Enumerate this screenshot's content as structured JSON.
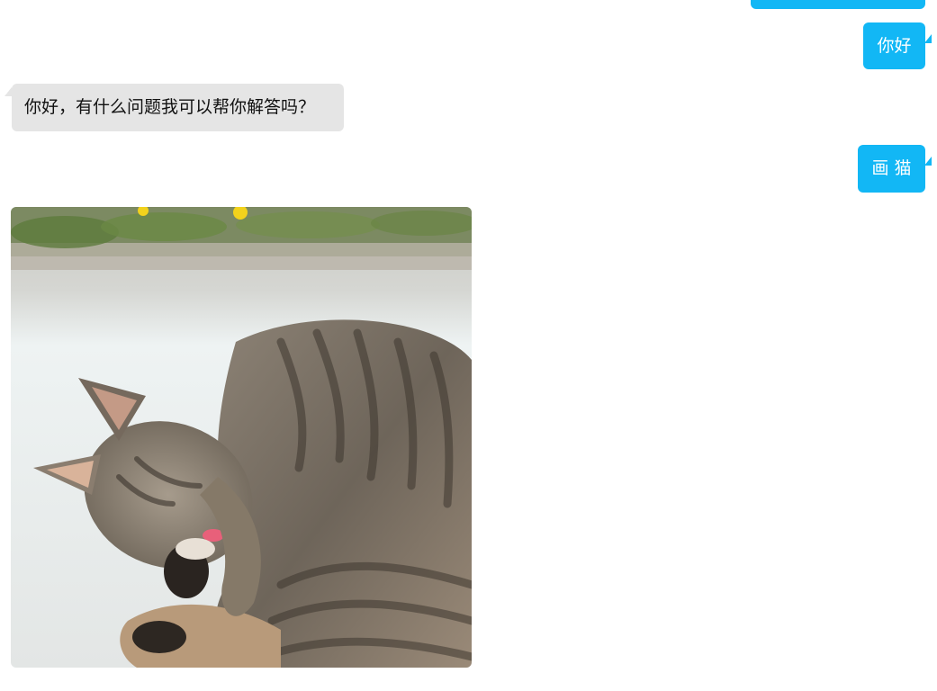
{
  "theme": {
    "user_bubble_color": "#12b7f5",
    "bot_bubble_color": "#e5e5e5"
  },
  "messages": [
    {
      "role": "user",
      "text": ""
    },
    {
      "role": "user",
      "text": "你好"
    },
    {
      "role": "assistant",
      "text": "你好，有什么问题我可以帮你解答吗？"
    },
    {
      "role": "user",
      "text": "画 猫"
    },
    {
      "role": "assistant",
      "type": "image",
      "icon": "tabby-cat-photo"
    }
  ]
}
